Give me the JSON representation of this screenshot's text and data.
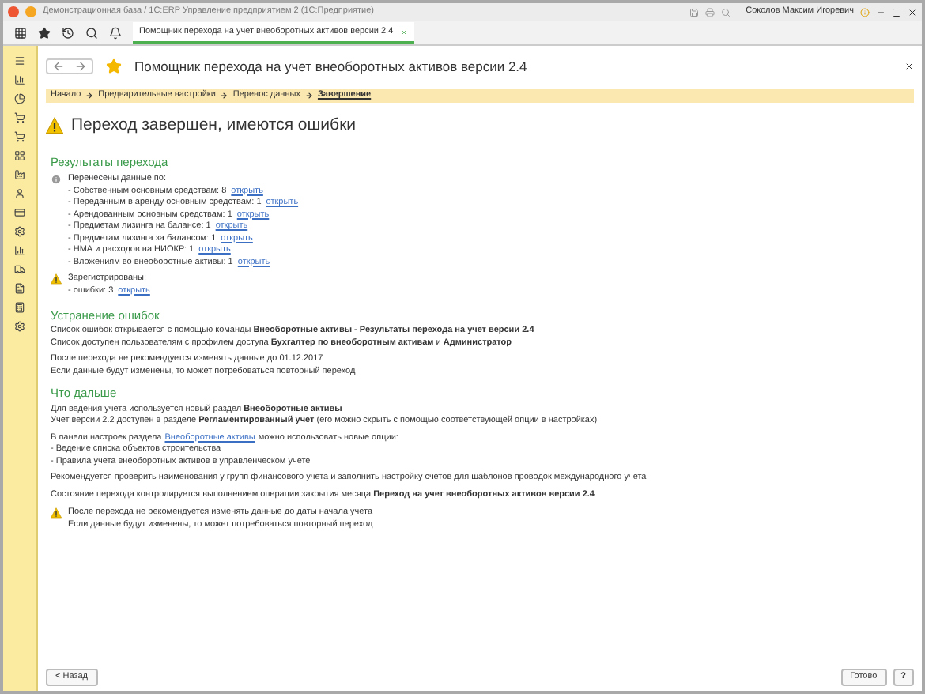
{
  "window": {
    "title": "Демонстрационная база / 1С:ERP Управление предприятием 2  (1С:Предприятие)",
    "user": "Соколов Максим Игоревич"
  },
  "tabs": [
    {
      "label": "Помощник перехода на учет внеоборотных активов версии 2.4",
      "selected": true
    }
  ],
  "form": {
    "title": "Помощник перехода на учет внеоборотных активов версии 2.4",
    "favorite": true
  },
  "steps": [
    {
      "label": "Начало",
      "selected": false
    },
    {
      "label": "Предварительные настройки",
      "selected": false
    },
    {
      "label": "Перенос данных",
      "selected": false
    },
    {
      "label": "Завершение",
      "selected": true
    }
  ],
  "heading": "Переход завершен, имеются ошибки",
  "results": {
    "title": "Результаты перехода",
    "transferred": {
      "label": "Перенесены данные по:",
      "items": [
        {
          "text": "- Собственным основным средствам: 8",
          "link": "открыть"
        },
        {
          "text": "- Переданным в аренду основным средствам: 1",
          "link": "открыть"
        },
        {
          "text": "- Арендованным основным средствам: 1",
          "link": "открыть"
        },
        {
          "text": "- Предметам лизинга на балансе: 1",
          "link": "открыть"
        },
        {
          "text": "- Предметам лизинга за балансом: 1",
          "link": "открыть"
        },
        {
          "text": "- НМА и расходов на НИОКР: 1",
          "link": "открыть"
        },
        {
          "text": "- Вложениям во внеоборотные активы: 1",
          "link": "открыть"
        }
      ]
    },
    "registered": {
      "label": "Зарегистрированы:",
      "items": [
        {
          "text": "- ошибки: 3",
          "link": "открыть"
        }
      ]
    }
  },
  "fix": {
    "title": "Устранение ошибок",
    "paragraphs": [
      [
        "Список ошибок открывается с помощью команды **Внеоборотные активы - Результаты перехода на учет версии 2.4**",
        "Список доступен пользователям с профилем доступа **Бухгалтер по внеоборотным активам** и **Администратор**"
      ],
      [
        "После перехода не рекомендуется изменять данные до 01.12.2017",
        "Если данные будут изменены, то может потребоваться повторный переход"
      ]
    ]
  },
  "next": {
    "title": "Что дальше",
    "paragraphs": [
      {
        "kind": "text",
        "lines": [
          "Для ведения учета используется новый раздел **Внеоборотные активы**",
          "Учет версии 2.2 доступен в разделе **Регламентированный учет** (его можно скрыть с помощью соответствующей опции в настройках)"
        ]
      },
      {
        "kind": "link",
        "before": "В панели настроек раздела",
        "link": "Внеоборотные активы",
        "after": "можно использовать новые опции:",
        "lines": [
          "- Ведение списка объектов строительства",
          "- Правила учета внеоборотных активов в управленческом учете"
        ]
      },
      {
        "kind": "text",
        "lines": [
          "Рекомендуется проверить наименования у групп финансового учета и заполнить настройку счетов для шаблонов проводок международного учета"
        ]
      },
      {
        "kind": "text",
        "lines": [
          "Состояние перехода контролируется выполнением операции закрытия месяца **Переход на учет внеоборотных активов версии 2.4**"
        ]
      }
    ]
  },
  "warning": [
    "После перехода не рекомендуется изменять данные до даты начала учета",
    "Если данные будут изменены, то может потребоваться повторный переход"
  ],
  "buttons": {
    "back": "< Назад",
    "done": "Готово",
    "help": "?"
  }
}
